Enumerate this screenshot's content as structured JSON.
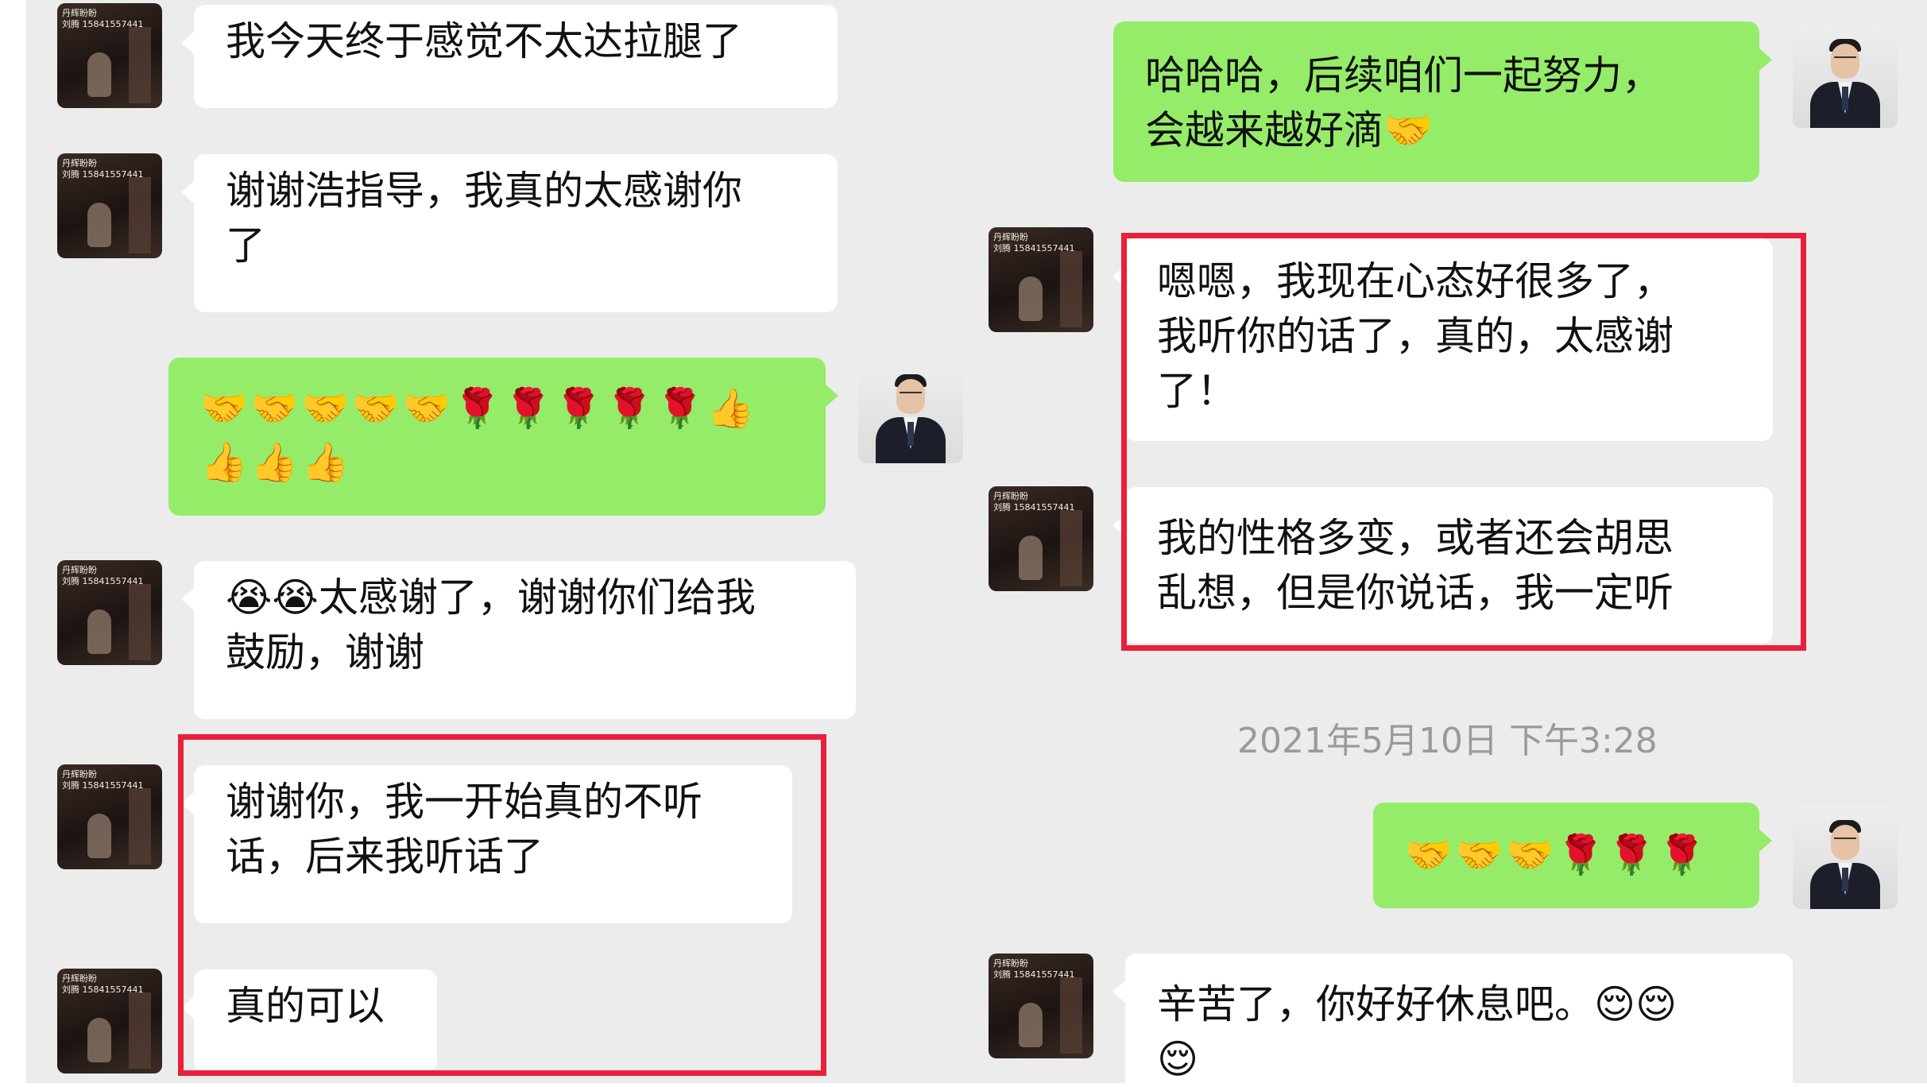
{
  "avatar_caption_line1": "丹辉盼盼",
  "avatar_caption_line2": "刘腾 15841557441",
  "left_messages": [
    {
      "lines": [
        "我今天终于感觉不太达拉腿了"
      ]
    },
    {
      "lines": [
        "谢谢浩指导，我真的太感谢你",
        "了"
      ]
    },
    {
      "lines": [
        "🤝🤝🤝🤝🤝🌹🌹🌹🌹🌹👍",
        "👍👍👍"
      ]
    },
    {
      "lines": [
        "😭😭太感谢了，谢谢你们给我",
        "鼓励，谢谢"
      ]
    },
    {
      "lines": [
        "谢谢你，我一开始真的不听",
        "话，后来我听话了"
      ]
    },
    {
      "lines": [
        "真的可以"
      ]
    }
  ],
  "right_messages": [
    {
      "lines": [
        "哈哈哈，后续咱们一起努力，",
        "会越来越好滴🤝"
      ]
    },
    {
      "lines": [
        "嗯嗯，我现在心态好很多了，",
        "我听你的话了，真的，太感谢",
        "了！"
      ]
    },
    {
      "lines": [
        "我的性格多变，或者还会胡思",
        "乱想，但是你说话，我一定听"
      ]
    },
    {
      "lines": [
        "🤝🤝🤝🌹🌹🌹"
      ]
    },
    {
      "lines": [
        "辛苦了，你好好休息吧。😌😌",
        "😌"
      ]
    }
  ],
  "timestamp": "2021年5月10日 下午3:28",
  "colors": {
    "sent_bubble": "#95ec69",
    "received_bubble": "#ffffff",
    "highlight": "#e8203a",
    "background": "#ececec"
  }
}
